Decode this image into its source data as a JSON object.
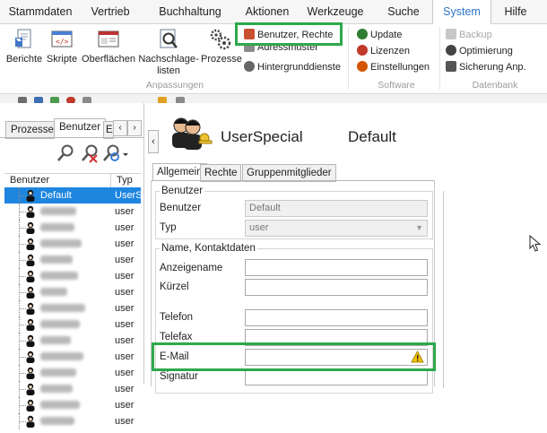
{
  "menu": {
    "items": [
      "Stammdaten",
      "Vertrieb",
      "Buchhaltung",
      "Aktionen",
      "Werkzeuge",
      "Suche",
      "System",
      "Hilfe"
    ],
    "active": "System"
  },
  "ribbon": {
    "anpassungen": {
      "label": "Anpassungen",
      "berichte": "Berichte",
      "skripte": "Skripte",
      "oberflaechen": "Oberflächen",
      "nachschlage1": "Nachschlage-",
      "nachschlage2": "listen",
      "prozesse": "Prozesse",
      "benutzer_rechte": "Benutzer, Rechte",
      "adressmuster": "Adressmuster",
      "hintergrunddienste": "Hintergrunddienste"
    },
    "software": {
      "label": "Software",
      "update": "Update",
      "lizenzen": "Lizenzen",
      "einstellungen": "Einstellungen"
    },
    "datenbank": {
      "label": "Datenbank",
      "backup": "Backup",
      "optimierung": "Optimierung",
      "sicherung": "Sicherung Anp."
    }
  },
  "left": {
    "tabs": [
      "Prozesse",
      "Benutzer",
      "E"
    ],
    "active_tab": "Benutzer",
    "columns": [
      "Benutzer",
      "Typ"
    ],
    "rows": [
      {
        "name": "Default",
        "typ": "UserS",
        "selected": true,
        "blur": 0
      },
      {
        "name": "",
        "typ": "user",
        "selected": false,
        "blur": 40
      },
      {
        "name": "",
        "typ": "user",
        "selected": false,
        "blur": 38
      },
      {
        "name": "",
        "typ": "user",
        "selected": false,
        "blur": 46
      },
      {
        "name": "",
        "typ": "user",
        "selected": false,
        "blur": 36
      },
      {
        "name": "",
        "typ": "user",
        "selected": false,
        "blur": 42
      },
      {
        "name": "",
        "typ": "user",
        "selected": false,
        "blur": 30
      },
      {
        "name": "",
        "typ": "user",
        "selected": false,
        "blur": 50
      },
      {
        "name": "",
        "typ": "user",
        "selected": false,
        "blur": 44
      },
      {
        "name": "",
        "typ": "user",
        "selected": false,
        "blur": 34
      },
      {
        "name": "",
        "typ": "user",
        "selected": false,
        "blur": 48
      },
      {
        "name": "",
        "typ": "user",
        "selected": false,
        "blur": 40
      },
      {
        "name": "",
        "typ": "user",
        "selected": false,
        "blur": 36
      },
      {
        "name": "",
        "typ": "user",
        "selected": false,
        "blur": 44
      },
      {
        "name": "",
        "typ": "user",
        "selected": false,
        "blur": 38
      }
    ]
  },
  "detail": {
    "title": "UserSpecial",
    "profile": "Default",
    "tabs": [
      "Allgemein",
      "Rechte",
      "Gruppenmitglieder"
    ],
    "active_tab": "Allgemein",
    "group_benutzer": "Benutzer",
    "benutzer_label": "Benutzer",
    "benutzer_value": "Default",
    "typ_label": "Typ",
    "typ_value": "user",
    "group_kontakt": "Name, Kontaktdaten",
    "anzeigename_label": "Anzeigename",
    "kuerzel_label": "Kürzel",
    "telefon_label": "Telefon",
    "telefax_label": "Telefax",
    "email_label": "E-Mail",
    "signatur_label": "Signatur"
  },
  "colors": {
    "highlight": "#2ea84a",
    "selection": "#1f86e0",
    "active_menu_text": "#2a73c5",
    "warning": "#f2c200"
  }
}
